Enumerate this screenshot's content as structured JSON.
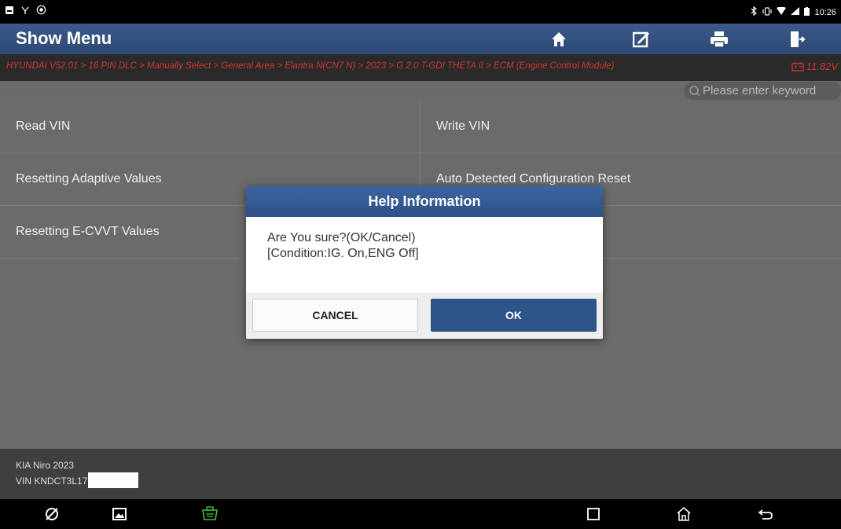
{
  "status_bar": {
    "time": "10:26"
  },
  "header": {
    "title": "Show Menu",
    "toolbar_icons": [
      "home-icon",
      "edit-icon",
      "print-icon",
      "exit-icon"
    ]
  },
  "breadcrumb": {
    "path": "HYUNDAI V52.01 > 16 PIN DLC > Manually Select > General Area > Elantra N(CN7 N) > 2023 > G 2.0 T-GDI THETA II > ECM (Engine Control Module)",
    "voltage": "11.82V"
  },
  "search": {
    "placeholder": "Please enter keyword"
  },
  "menu": {
    "items": [
      {
        "label": "Read VIN"
      },
      {
        "label": "Write VIN"
      },
      {
        "label": "Resetting Adaptive Values"
      },
      {
        "label": "Auto Detected Configuration Reset"
      },
      {
        "label": "Resetting E-CVVT Values"
      }
    ]
  },
  "footer": {
    "vehicle": "KIA Niro  2023",
    "vin": "VIN KNDCT3L17"
  },
  "dialog": {
    "title": "Help Information",
    "message_line1": "Are You sure?(OK/Cancel)",
    "message_line2": "[Condition:IG. On,ENG Off]",
    "cancel_label": "CANCEL",
    "ok_label": "OK"
  },
  "colors": {
    "header": "#2c4874",
    "breadcrumb_text": "#d2352c",
    "ok_button": "#2d5589"
  }
}
